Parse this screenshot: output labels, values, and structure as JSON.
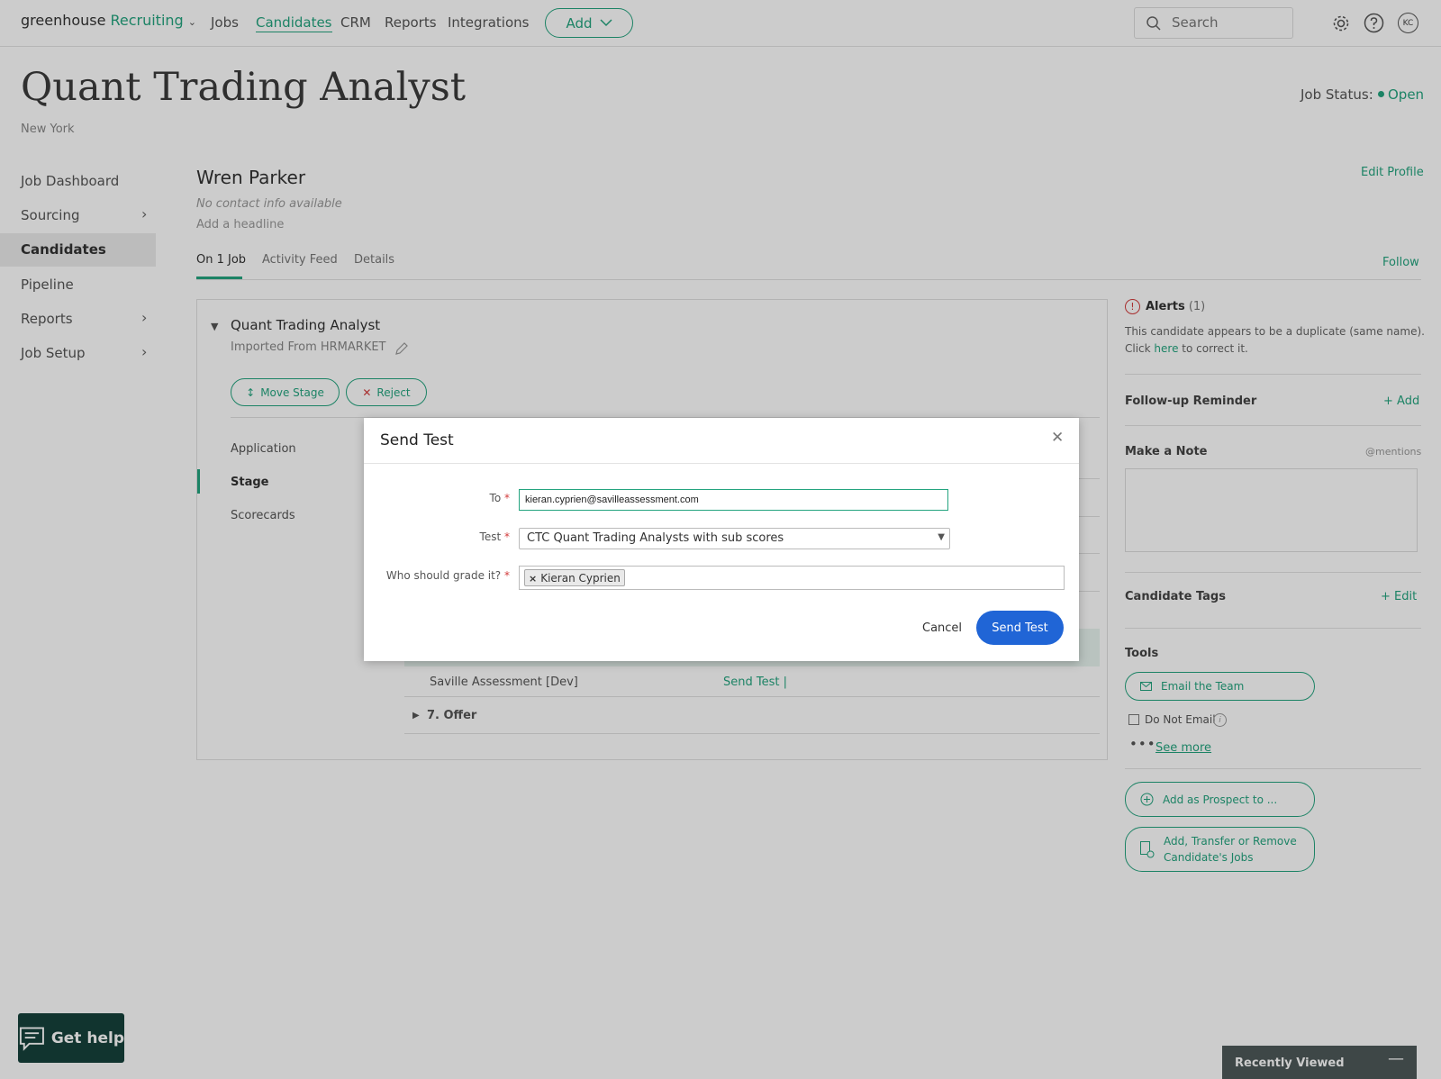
{
  "topnav": {
    "brand": "greenhouse",
    "brand_product": "Recruiting",
    "items": [
      "Jobs",
      "Candidates",
      "CRM",
      "Reports",
      "Integrations"
    ],
    "active_item": "Candidates",
    "add_label": "Add",
    "search_placeholder": "Search",
    "avatar_initials": "KC"
  },
  "job": {
    "title": "Quant Trading Analyst",
    "location": "New York",
    "status_label": "Job Status:",
    "status_value": "Open"
  },
  "sidebar": {
    "items": [
      {
        "label": "Job Dashboard",
        "has_chevron": false
      },
      {
        "label": "Sourcing",
        "has_chevron": true
      },
      {
        "label": "Candidates",
        "has_chevron": false,
        "active": true
      },
      {
        "label": "Pipeline",
        "has_chevron": false
      },
      {
        "label": "Reports",
        "has_chevron": true
      },
      {
        "label": "Job Setup",
        "has_chevron": true
      }
    ]
  },
  "candidate": {
    "name": "Wren Parker",
    "contact": "No contact info available",
    "headline": "Add a headline",
    "edit_profile": "Edit Profile",
    "follow": "Follow",
    "tabs": [
      "On 1 Job",
      "Activity Feed",
      "Details"
    ]
  },
  "job_card": {
    "title": "Quant Trading Analyst",
    "source": "Imported From HRMARKET",
    "move_stage": "Move Stage",
    "reject": "Reject",
    "links": [
      "Application",
      "Stage",
      "Scorecards"
    ],
    "test_name": "Saville Assessment [Dev]",
    "test_action": "Send Test |",
    "offer_stage": "7.  Offer"
  },
  "right_sidebar": {
    "alerts_title": "Alerts",
    "alerts_count": "(1)",
    "alert_line1": "This candidate appears to be a duplicate (same name).",
    "alert_line2_pre": "Click",
    "alert_line2_link": "here",
    "alert_line2_post": "to correct it.",
    "followup": "Follow-up Reminder",
    "followup_add": "+ Add",
    "note": "Make a Note",
    "mentions": "@mentions",
    "tags": "Candidate Tags",
    "tags_edit": "+ Edit",
    "tools": "Tools",
    "email_team": "Email the Team",
    "do_not_email": "Do Not Email",
    "see_more": "See more",
    "add_prospect": "Add as Prospect to ...",
    "transfer_line1": "Add, Transfer or Remove",
    "transfer_line2": "Candidate's Jobs"
  },
  "help": {
    "label": "Get help"
  },
  "recently_viewed": {
    "label": "Recently Viewed"
  },
  "modal": {
    "title": "Send Test",
    "to_label": "To",
    "to_value": "kieran.cyprien@savilleassessment.com",
    "test_label": "Test",
    "test_value": "CTC Quant Trading Analysts with sub scores",
    "grader_label": "Who should grade it?",
    "grader_tag": "Kieran Cyprien",
    "cancel": "Cancel",
    "send": "Send Test"
  },
  "colors": {
    "accent_green": "#24a47f",
    "primary_blue": "#2065d6",
    "alert_red": "#d23b3b",
    "help_bg": "#16413b"
  }
}
